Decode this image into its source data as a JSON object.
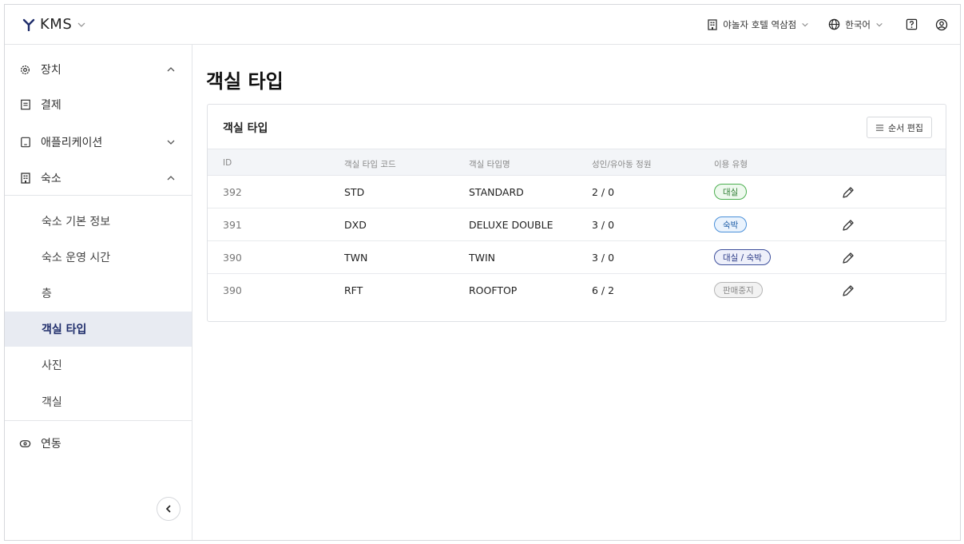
{
  "header": {
    "brand": "KMS",
    "hotel": "야놀자 호텔 역삼점",
    "language": "한국어",
    "help_icon": "help-icon",
    "account_icon": "user-circle-icon"
  },
  "sidebar": {
    "items": [
      {
        "label": "장치",
        "icon": "gear-icon",
        "chevron": "up"
      },
      {
        "label": "결제",
        "icon": "receipt-icon"
      },
      {
        "label": "애플리케이션",
        "icon": "tablet-icon",
        "chevron": "down"
      },
      {
        "label": "숙소",
        "icon": "building-icon",
        "chevron": "up"
      }
    ],
    "subitems": [
      {
        "label": "숙소 기본 정보"
      },
      {
        "label": "숙소 운영 시간"
      },
      {
        "label": "층"
      },
      {
        "label": "객실 타입",
        "active": true
      },
      {
        "label": "사진"
      },
      {
        "label": "객실"
      }
    ],
    "link": {
      "label": "연동",
      "icon": "link-icon"
    }
  },
  "main": {
    "title": "객실 타입",
    "card": {
      "title": "객실 타입",
      "order_button": "순서 편집",
      "columns": [
        "ID",
        "객실 타입 코드",
        "객실 타입명",
        "성인/유아동 정원",
        "이용 유형"
      ],
      "rows": [
        {
          "id": "392",
          "code": "STD",
          "name": "STANDARD",
          "capacity": "2 / 0",
          "type": "대실",
          "type_style": "daesil"
        },
        {
          "id": "391",
          "code": "DXD",
          "name": "DELUXE DOUBLE",
          "capacity": "3 / 0",
          "type": "숙박",
          "type_style": "sukbak"
        },
        {
          "id": "390",
          "code": "TWN",
          "name": "TWIN",
          "capacity": "3 / 0",
          "type": "대실 / 숙박",
          "type_style": "both"
        },
        {
          "id": "390",
          "code": "RFT",
          "name": "ROOFTOP",
          "capacity": "6 / 2",
          "type": "판매중지",
          "type_style": "stop"
        }
      ]
    }
  },
  "colors": {
    "active_bg": "#e8ebf2",
    "active_text": "#1f2d6b",
    "badge_daesil": "#4caf50",
    "badge_sukbak": "#4a90d9",
    "badge_both": "#3d4f9c",
    "badge_stop": "#b5b5b5"
  }
}
